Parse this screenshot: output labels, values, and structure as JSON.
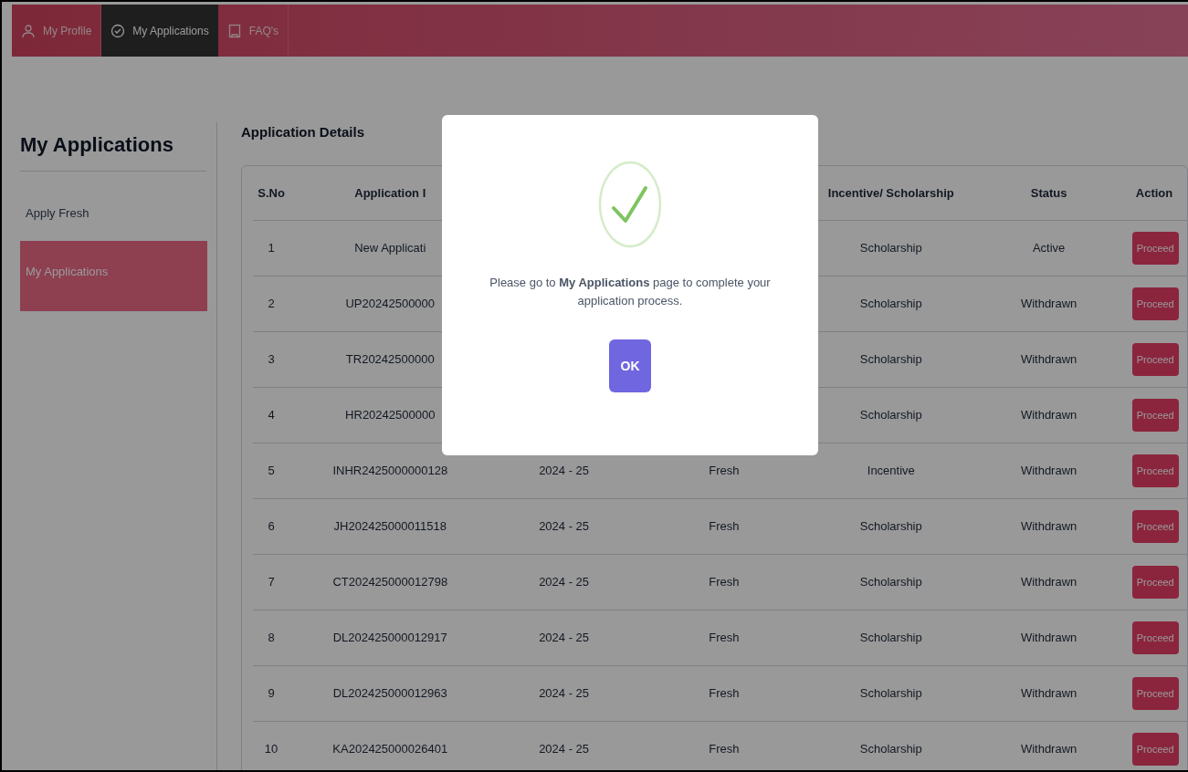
{
  "nav": {
    "tabs": [
      {
        "label": "My Profile",
        "selected": false
      },
      {
        "label": "My Applications",
        "selected": true
      },
      {
        "label": "FAQ's",
        "selected": false
      }
    ]
  },
  "sidebar": {
    "title": "My Applications",
    "items": [
      {
        "label": "Apply Fresh",
        "selected": false
      },
      {
        "label": "My Applications",
        "selected": true
      }
    ]
  },
  "main": {
    "title": "Application Details",
    "table": {
      "columns": [
        "S.No",
        "Application I",
        "",
        "",
        "Incentive/ Scholarship",
        "Status",
        "Action"
      ],
      "rows": [
        {
          "sno": "1",
          "application_id": "New Applicati",
          "incentive": "Scholarship",
          "status": "Active",
          "action": "Proceed"
        },
        {
          "sno": "2",
          "application_id": "UP20242500000",
          "incentive": "Scholarship",
          "status": "Withdrawn",
          "action": "Proceed"
        },
        {
          "sno": "3",
          "application_id": "TR20242500000",
          "incentive": "Scholarship",
          "status": "Withdrawn",
          "action": "Proceed"
        },
        {
          "sno": "4",
          "application_id": "HR20242500000",
          "incentive": "Scholarship",
          "status": "Withdrawn",
          "action": "Proceed"
        },
        {
          "sno": "5",
          "application_id": "INHR2425000000128",
          "column_3": "2024 - 25",
          "column_4": "Fresh",
          "incentive": "Incentive",
          "status": "Withdrawn",
          "action": "Proceed"
        },
        {
          "sno": "6",
          "application_id": "JH202425000011518",
          "column_3": "2024 - 25",
          "column_4": "Fresh",
          "incentive": "Scholarship",
          "status": "Withdrawn",
          "action": "Proceed"
        },
        {
          "sno": "7",
          "application_id": "CT202425000012798",
          "column_3": "2024 - 25",
          "column_4": "Fresh",
          "incentive": "Scholarship",
          "status": "Withdrawn",
          "action": "Proceed"
        },
        {
          "sno": "8",
          "application_id": "DL202425000012917",
          "column_3": "2024 - 25",
          "column_4": "Fresh",
          "incentive": "Scholarship",
          "status": "Withdrawn",
          "action": "Proceed"
        },
        {
          "sno": "9",
          "application_id": "DL202425000012963",
          "column_3": "2024 - 25",
          "column_4": "Fresh",
          "incentive": "Scholarship",
          "status": "Withdrawn",
          "action": "Proceed"
        },
        {
          "sno": "10",
          "application_id": "KA202425000026401",
          "column_3": "2024 - 25",
          "column_4": "Fresh",
          "incentive": "Scholarship",
          "status": "Withdrawn",
          "action": "Proceed"
        }
      ]
    }
  },
  "modal": {
    "message": "Please go to **My Applications** page to complete your application process.",
    "button": "OK"
  }
}
